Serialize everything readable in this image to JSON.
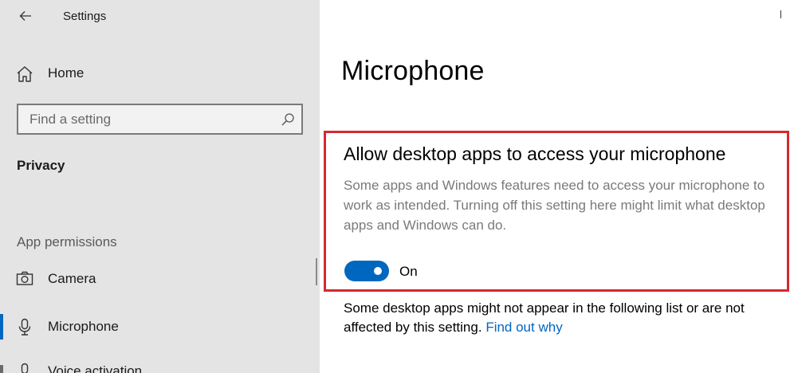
{
  "window": {
    "title": "Settings"
  },
  "sidebar": {
    "home_label": "Home",
    "search": {
      "placeholder": "Find a setting"
    },
    "section_title": "Privacy",
    "group_title": "App permissions",
    "items": [
      {
        "label": "Camera",
        "icon": "camera-icon"
      },
      {
        "label": "Microphone",
        "icon": "microphone-icon",
        "selected": true
      },
      {
        "label": "Voice activation",
        "icon": "voice-activation-icon"
      }
    ]
  },
  "main": {
    "title": "Microphone",
    "section": {
      "heading": "Allow desktop apps to access your microphone",
      "description": "Some apps and Windows features need to access your microphone to work as intended. Turning off this setting here might limit what desktop apps and Windows can do.",
      "toggle_state": "On"
    },
    "note": {
      "text": "Some desktop apps might not appear in the following list or are not affected by this setting.",
      "link": "Find out why"
    }
  },
  "colors": {
    "accent": "#0067c0",
    "highlight_border": "#d52a2f",
    "sidebar_bg": "#e4e4e4"
  }
}
